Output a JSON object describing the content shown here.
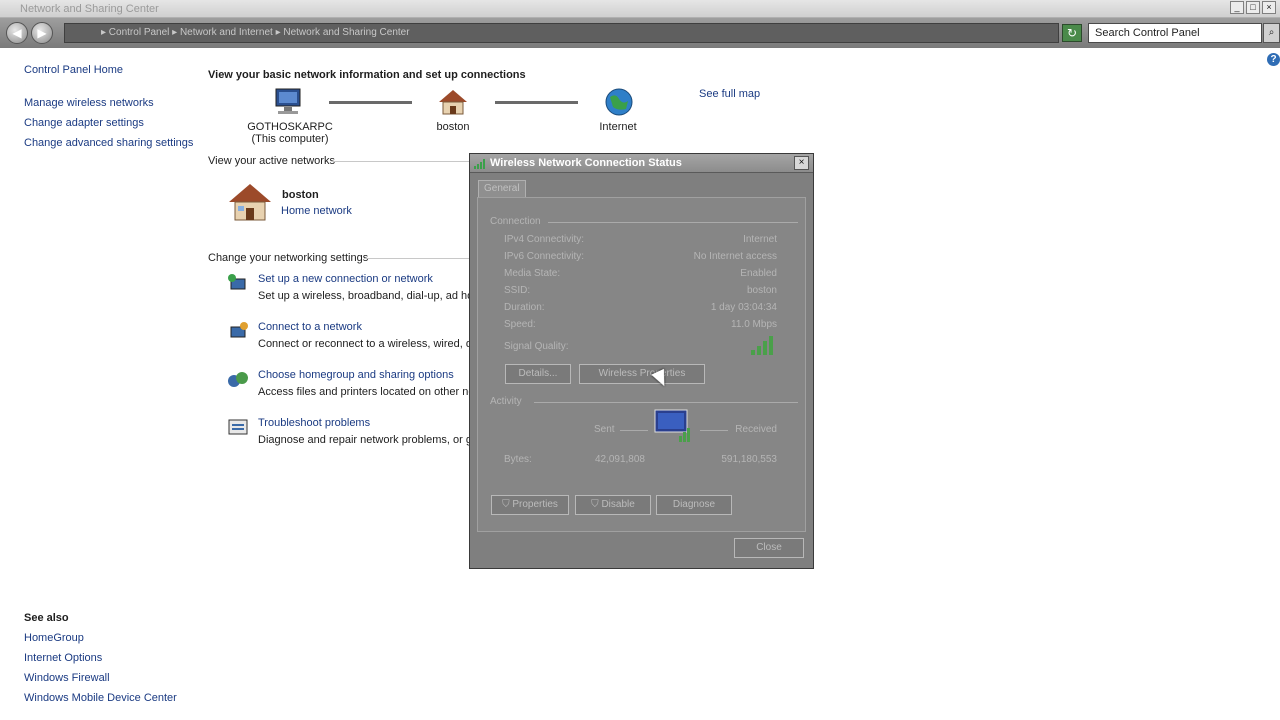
{
  "window": {
    "title": "Network and Sharing Center",
    "controls": [
      "_",
      "□",
      "×"
    ]
  },
  "address": {
    "breadcrumb": [
      "Control Panel",
      "Network and Internet",
      "Network and Sharing Center"
    ],
    "breadcrumb_text": "▸  Control Panel  ▸  Network and Internet  ▸  Network and Sharing Center",
    "search_placeholder": "Search Control Panel",
    "back_icon": "back-arrow-icon",
    "forward_icon": "forward-arrow-icon"
  },
  "sidebar": {
    "home": "Control Panel Home",
    "items": [
      "Manage wireless networks",
      "Change adapter settings",
      "Change advanced sharing settings"
    ],
    "see_also_title": "See also",
    "see_also": [
      "HomeGroup",
      "Internet Options",
      "Windows Firewall",
      "Windows Mobile Device Center"
    ]
  },
  "main": {
    "heading": "View your basic network information and set up connections",
    "see_full_map": "See full map",
    "map": {
      "computer_name": "GOTHOSKARPC",
      "computer_sub": "(This computer)",
      "network": "boston",
      "internet": "Internet"
    },
    "active_networks_title": "View your active networks",
    "active_network": {
      "name": "boston",
      "type": "Home network"
    },
    "settings_title": "Change your networking settings",
    "tasks": [
      {
        "title": "Set up a new connection or network",
        "desc": "Set up a wireless, broadband, dial-up, ad hoc,"
      },
      {
        "title": "Connect to a network",
        "desc": "Connect or reconnect to a wireless, wired, dial"
      },
      {
        "title": "Choose homegroup and sharing options",
        "desc": "Access files and printers located on other netw"
      },
      {
        "title": "Troubleshoot problems",
        "desc": "Diagnose and repair network problems, or get"
      }
    ]
  },
  "dialog": {
    "title": "Wireless Network Connection Status",
    "close_glyph": "×",
    "tab": "General",
    "connection_label": "Connection",
    "rows": [
      {
        "label": "IPv4 Connectivity:",
        "value": "Internet"
      },
      {
        "label": "IPv6 Connectivity:",
        "value": "No Internet access"
      },
      {
        "label": "Media State:",
        "value": "Enabled"
      },
      {
        "label": "SSID:",
        "value": "boston"
      },
      {
        "label": "Duration:",
        "value": "1 day 03:04:34"
      },
      {
        "label": "Speed:",
        "value": "11.0 Mbps"
      }
    ],
    "signal_label": "Signal Quality:",
    "details_button": "Details...",
    "wireless_properties_button": "Wireless Properties",
    "activity_label": "Activity",
    "sent_label": "Sent",
    "received_label": "Received",
    "bytes_label": "Bytes:",
    "bytes_sent": "42,091,808",
    "bytes_received": "591,180,553",
    "properties_button": "Properties",
    "disable_button": "Disable",
    "diagnose_button": "Diagnose",
    "close_button": "Close"
  }
}
